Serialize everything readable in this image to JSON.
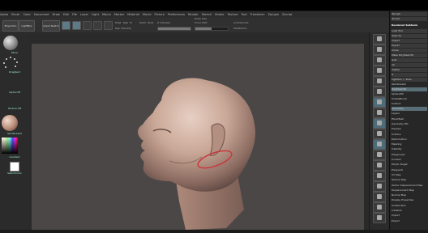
{
  "app": {
    "title": "ZBrush 4R6"
  },
  "menu": [
    "Alpha",
    "Brush",
    "Color",
    "Document",
    "Draw",
    "Edit",
    "File",
    "Layer",
    "Light",
    "Macro",
    "Marker",
    "Material",
    "Movie",
    "Picture",
    "Preferences",
    "Render",
    "Stencil",
    "Stroke",
    "Texture",
    "Tool",
    "Transform",
    "Zplugin",
    "Zscript"
  ],
  "toolbar": {
    "projection_master": "Projection Master",
    "lightbox": "LightBox",
    "quick_sketch": "Quick Sketch",
    "edit": "Edit",
    "draw": "Draw",
    "move": "Move",
    "scale": "Scale",
    "rotate": "Rotate",
    "mrgb": "Mrgb",
    "rgb": "Rgb",
    "m": "M",
    "zadd": "Zadd",
    "zsub": "Zsub",
    "z_intensity": "Z Intensity",
    "focal_shift": "Focal Shift",
    "draw_size": "Draw Size",
    "dynamic": "Dynamic",
    "active_points": "ActivePoints:",
    "total_points": "TotalPoints:",
    "rgb_intensity": "Rgb Intensity",
    "z_intensity_value": 100,
    "rgb_intensity_value": 100,
    "focal_shift_value": 0,
    "draw_size_value": 64
  },
  "left_shelf": {
    "brush_label": "Move",
    "stroke_label": "DragRect",
    "alpha_label": "Alpha Off",
    "texture_label": "Texture Off",
    "material_label": "SkinShade4",
    "gradient_label": "Gradient",
    "switch_color_label": "SwitchColor"
  },
  "right_tray": {
    "top_rows": [
      "Zplugin",
      "Zscript"
    ],
    "section_title": "Rendered Subtools",
    "rows": [
      "Load Tool",
      "Save As",
      "Import",
      "Export",
      "Clone",
      "Make PolyMesh3D",
      "GoZ",
      "All",
      "Visible",
      "R",
      "Lightbox > Tools",
      "SkinShade4",
      "PolyMesh3D",
      "Sphere3D",
      "SimpleBrush",
      "Subtool",
      "Geometry",
      "Layers",
      "FiberMesh",
      "Geometry HD",
      "Preview",
      "Surface",
      "Deformation",
      "Masking",
      "Visibility",
      "Polygroups",
      "Contact",
      "Morph Target",
      "Polypaint",
      "UV Map",
      "Texture Map",
      "Vector Displacement Map",
      "Displacement Map",
      "Normal Map",
      "Display Properties",
      "Unified Skin",
      "Initialize",
      "Import",
      "Export"
    ],
    "spotlight": "SPix",
    "values": {
      "spix": 3,
      "r": 64
    }
  },
  "colors": {
    "canvas": "#4b4747",
    "selected": "#5a6e78",
    "annotation": "#c8383c",
    "skin": "#c9a797"
  }
}
